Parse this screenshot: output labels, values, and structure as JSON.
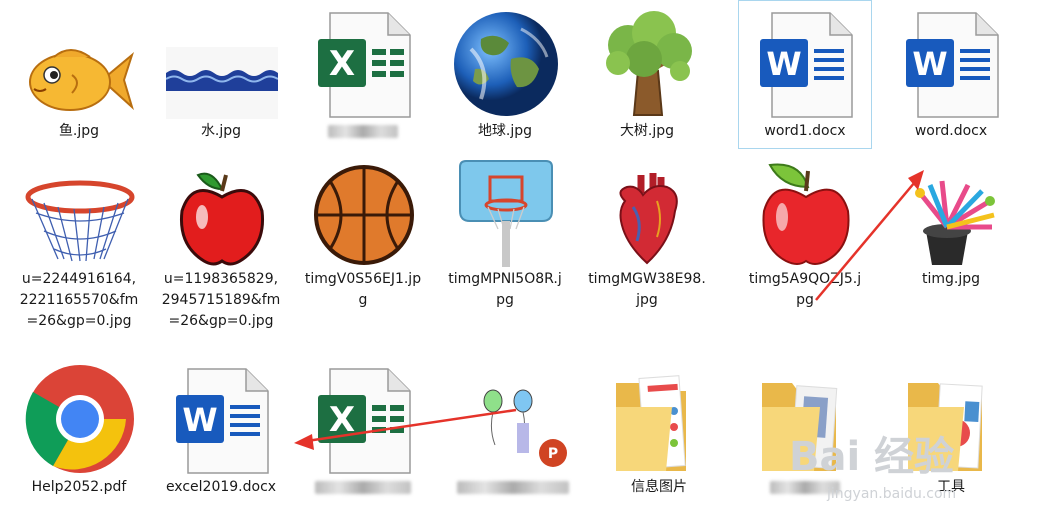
{
  "files": [
    {
      "label": "鱼.jpg",
      "icon": "fish-image-icon"
    },
    {
      "label": "水.jpg",
      "icon": "water-image-icon"
    },
    {
      "label": "",
      "icon": "excel-file-icon",
      "redacted": true
    },
    {
      "label": "地球.jpg",
      "icon": "earth-image-icon"
    },
    {
      "label": "大树.jpg",
      "icon": "tree-image-icon"
    },
    {
      "label": "word1.docx",
      "icon": "word-file-icon",
      "selected": true
    },
    {
      "label": "word.docx",
      "icon": "word-file-icon"
    },
    {
      "label": "u=2244916164,2221165570&fm=26&gp=0.jpg",
      "icon": "basketball-hoop-image-icon"
    },
    {
      "label": "u=1198365829,2945715189&fm=26&gp=0.jpg",
      "icon": "apple-image-icon"
    },
    {
      "label": "timgV0S56EJ1.jpg",
      "icon": "basketball-image-icon"
    },
    {
      "label": "timgMPNI5O8R.jpg",
      "icon": "backboard-image-icon"
    },
    {
      "label": "timgMGW38E98.jpg",
      "icon": "heart-image-icon"
    },
    {
      "label": "timg5A9QOZJ5.jpg",
      "icon": "apple-image-icon"
    },
    {
      "label": "timg.jpg",
      "icon": "magic-hat-image-icon"
    },
    {
      "label": "Help2052.pdf",
      "icon": "chrome-pdf-icon"
    },
    {
      "label": "excel2019.docx",
      "icon": "word-file-icon"
    },
    {
      "label": "",
      "icon": "excel-file-icon",
      "redacted": true
    },
    {
      "label": "",
      "icon": "balloons-powerpoint-icon",
      "redacted": true
    },
    {
      "label": "信息图片",
      "icon": "folder-icon"
    },
    {
      "label": "",
      "icon": "folder-icon",
      "redacted": true
    },
    {
      "label": "工具",
      "icon": "folder-icon"
    }
  ],
  "watermark": {
    "text": "Bai  经验",
    "sub": "jingyan.baidu.com"
  },
  "colors": {
    "word": "#185abd",
    "excel": "#1d6f42",
    "arrow": "#e5332a",
    "selection": "#a9d6ee"
  }
}
